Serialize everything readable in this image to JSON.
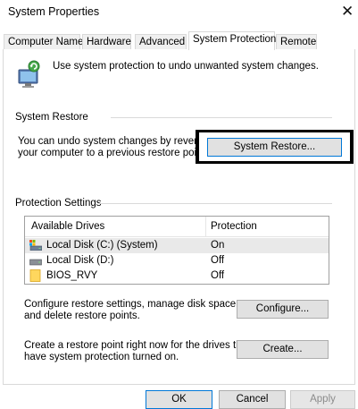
{
  "window": {
    "title": "System Properties",
    "close_glyph": "✕"
  },
  "tabs": [
    {
      "label": "Computer Name",
      "active": false
    },
    {
      "label": "Hardware",
      "active": false
    },
    {
      "label": "Advanced",
      "active": false
    },
    {
      "label": "System Protection",
      "active": true
    },
    {
      "label": "Remote",
      "active": false
    }
  ],
  "intro": {
    "text": "Use system protection to undo unwanted system changes.",
    "icon": "system-protection-icon"
  },
  "system_restore": {
    "group_label": "System Restore",
    "description_line1": "You can undo system changes by revertin",
    "description_line2": "your computer to a previous restore point.",
    "button_label": "System Restore..."
  },
  "protection": {
    "group_label": "Protection Settings",
    "columns": [
      "Available Drives",
      "Protection"
    ],
    "drives": [
      {
        "name": "Local Disk (C:) (System)",
        "protection": "On",
        "icon": "system-drive-icon",
        "selected": true
      },
      {
        "name": "Local Disk (D:)",
        "protection": "Off",
        "icon": "drive-icon",
        "selected": false
      },
      {
        "name": "BIOS_RVY",
        "protection": "Off",
        "icon": "folder-drive-icon",
        "selected": false
      }
    ]
  },
  "configure": {
    "line1": "Configure restore settings, manage disk space,",
    "line2": "and delete restore points.",
    "button_label": "Configure..."
  },
  "create": {
    "line1": "Create a restore point right now for the drives that",
    "line2": "have system protection turned on.",
    "button_label": "Create..."
  },
  "footer": {
    "ok_label": "OK",
    "cancel_label": "Cancel",
    "apply_label": "Apply"
  }
}
